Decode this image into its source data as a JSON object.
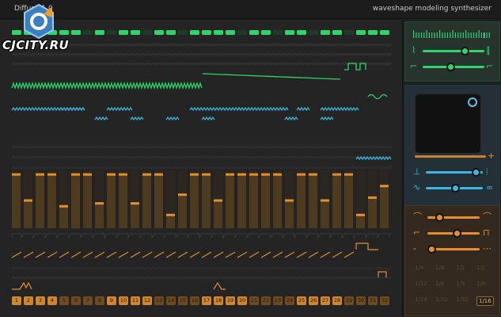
{
  "header": {
    "title": "Diffuse 1.0",
    "subtitle": "waveshape modeling synthesizer"
  },
  "watermark": {
    "text": "CJCITY.RU"
  },
  "colors": {
    "green": "#2fd46a",
    "cyan": "#3bb8e0",
    "orange": "#e58e2a",
    "bar_fill": "#4d3a1f",
    "bar_dim": "#2e2e2e"
  },
  "steps": [
    "1",
    "2",
    "3",
    "4",
    "5",
    "6",
    "7",
    "8",
    "9",
    "10",
    "11",
    "12",
    "13",
    "14",
    "15",
    "16",
    "17",
    "18",
    "19",
    "20",
    "21",
    "22",
    "23",
    "24",
    "25",
    "26",
    "27",
    "28",
    "29",
    "30",
    "31",
    "32"
  ],
  "step_levels": [
    0.95,
    0.5,
    0.95,
    0.95,
    0.4,
    0.95,
    0.95,
    0.45,
    0.95,
    0.95,
    0.45,
    0.95,
    0.95,
    0.25,
    0.6,
    0.95,
    0.95,
    0.5,
    0.95,
    0.95,
    0.95,
    0.95,
    0.95,
    0.5,
    0.95,
    0.95,
    0.5,
    0.95,
    0.95,
    0.25,
    0.55,
    0.75
  ],
  "right_panel": {
    "rates": [
      "1/4",
      "1/4",
      "1/2",
      "1/2",
      "1/12",
      "1/8",
      "1/8",
      "1/8",
      "1/24",
      "1/32",
      "1/32",
      "1/16"
    ],
    "selected_rate": "1/16"
  }
}
